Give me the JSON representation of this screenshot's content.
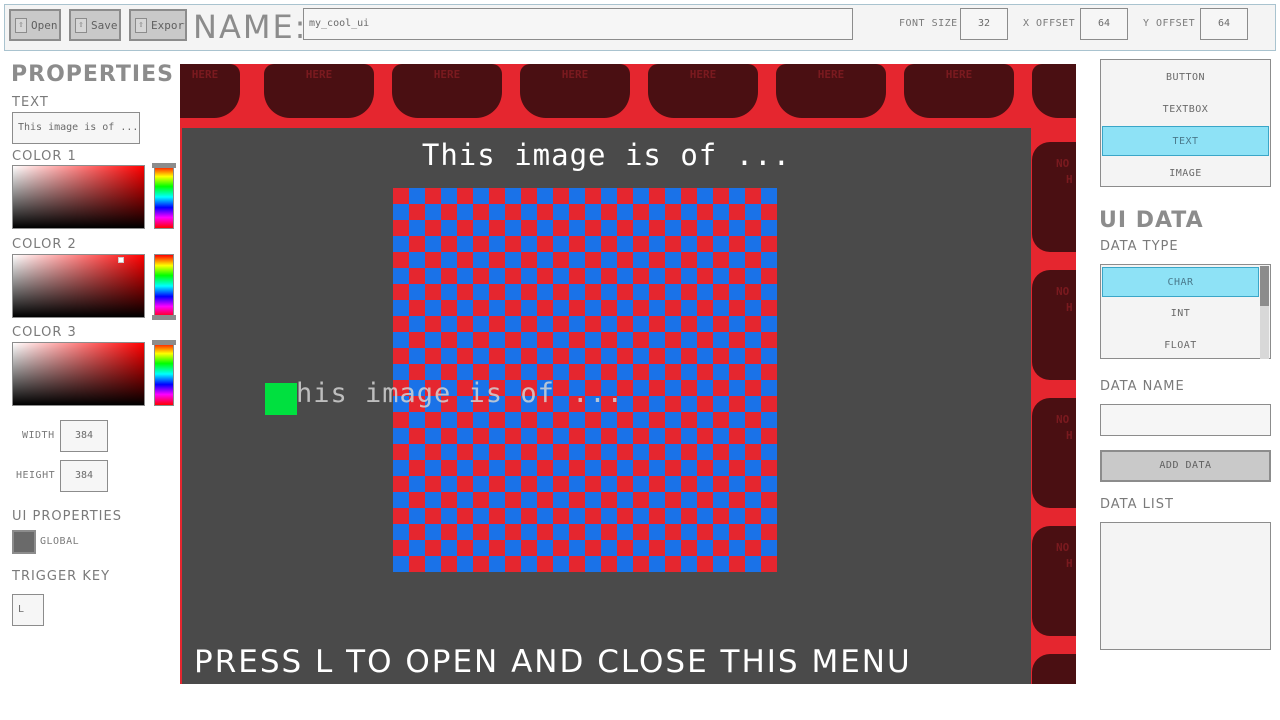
{
  "toolbar": {
    "open_label": "Open",
    "save_label": "Save",
    "export_label": "Export",
    "name_label": "NAME:",
    "name_value": "my_cool_ui",
    "font_size_label": "FONT SIZE",
    "font_size_value": "32",
    "x_offset_label": "X OFFSET",
    "x_offset_value": "64",
    "y_offset_label": "Y OFFSET",
    "y_offset_value": "64"
  },
  "properties": {
    "title": "PROPERTIES",
    "text_label": "TEXT",
    "text_value": "This image is of ...",
    "color1_label": "COLOR 1",
    "color2_label": "COLOR 2",
    "color3_label": "COLOR 3",
    "width_label": "WIDTH",
    "width_value": "384",
    "height_label": "HEIGHT",
    "height_value": "384",
    "ui_properties_label": "UI PROPERTIES",
    "global_label": "GLOBAL",
    "trigger_key_label": "TRIGGER KEY",
    "trigger_key_value": "L"
  },
  "canvas": {
    "placeholder_text": "HERE",
    "side_text_1": "NO",
    "side_text_2": "H",
    "menu_title": "This image is of ...",
    "ghost_text": "his image is of ...",
    "footer": "PRESS L TO OPEN AND CLOSE THIS MENU",
    "colors": {
      "background": "#e5262f",
      "menu": "#4a4a4a",
      "checker_a": "#e5262f",
      "checker_b": "#1a72e8",
      "green": "#00e03f"
    }
  },
  "element_types": {
    "items": [
      "BUTTON",
      "TEXTBOX",
      "TEXT",
      "IMAGE"
    ],
    "selected": "TEXT"
  },
  "ui_data": {
    "title": "UI DATA",
    "data_type_label": "DATA TYPE",
    "types": [
      "CHAR",
      "INT",
      "FLOAT"
    ],
    "selected_type": "CHAR",
    "data_name_label": "DATA NAME",
    "data_name_value": "",
    "add_data_label": "ADD DATA",
    "data_list_label": "DATA LIST"
  },
  "accent_color": "#8ee2f6"
}
